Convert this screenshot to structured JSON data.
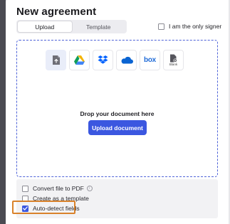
{
  "modal": {
    "title": "New agreement",
    "tabs": [
      {
        "label": "Upload",
        "active": true
      },
      {
        "label": "Template",
        "active": false
      }
    ],
    "only_signer": {
      "label": "I am the only signer",
      "checked": false
    }
  },
  "dropzone": {
    "sources": [
      {
        "icon": "upload-file-icon",
        "selected": true
      },
      {
        "icon": "google-drive-icon",
        "selected": false
      },
      {
        "icon": "dropbox-icon",
        "selected": false
      },
      {
        "icon": "onedrive-icon",
        "selected": false
      },
      {
        "icon": "box-icon",
        "text": "box",
        "selected": false
      },
      {
        "icon": "blank-document-icon",
        "text": "Blank",
        "selected": false
      }
    ],
    "drop_text": "Drop your document here",
    "upload_button": "Upload document"
  },
  "options": {
    "convert_pdf": {
      "label": "Convert file to PDF",
      "checked": false
    },
    "create_template": {
      "label": "Create as a template",
      "checked": false
    },
    "auto_detect": {
      "label": "Auto-detect fields",
      "checked": true
    }
  },
  "colors": {
    "accent": "#3b57e0",
    "highlight": "#d9822b",
    "dropzone_border": "#4f63d8"
  }
}
